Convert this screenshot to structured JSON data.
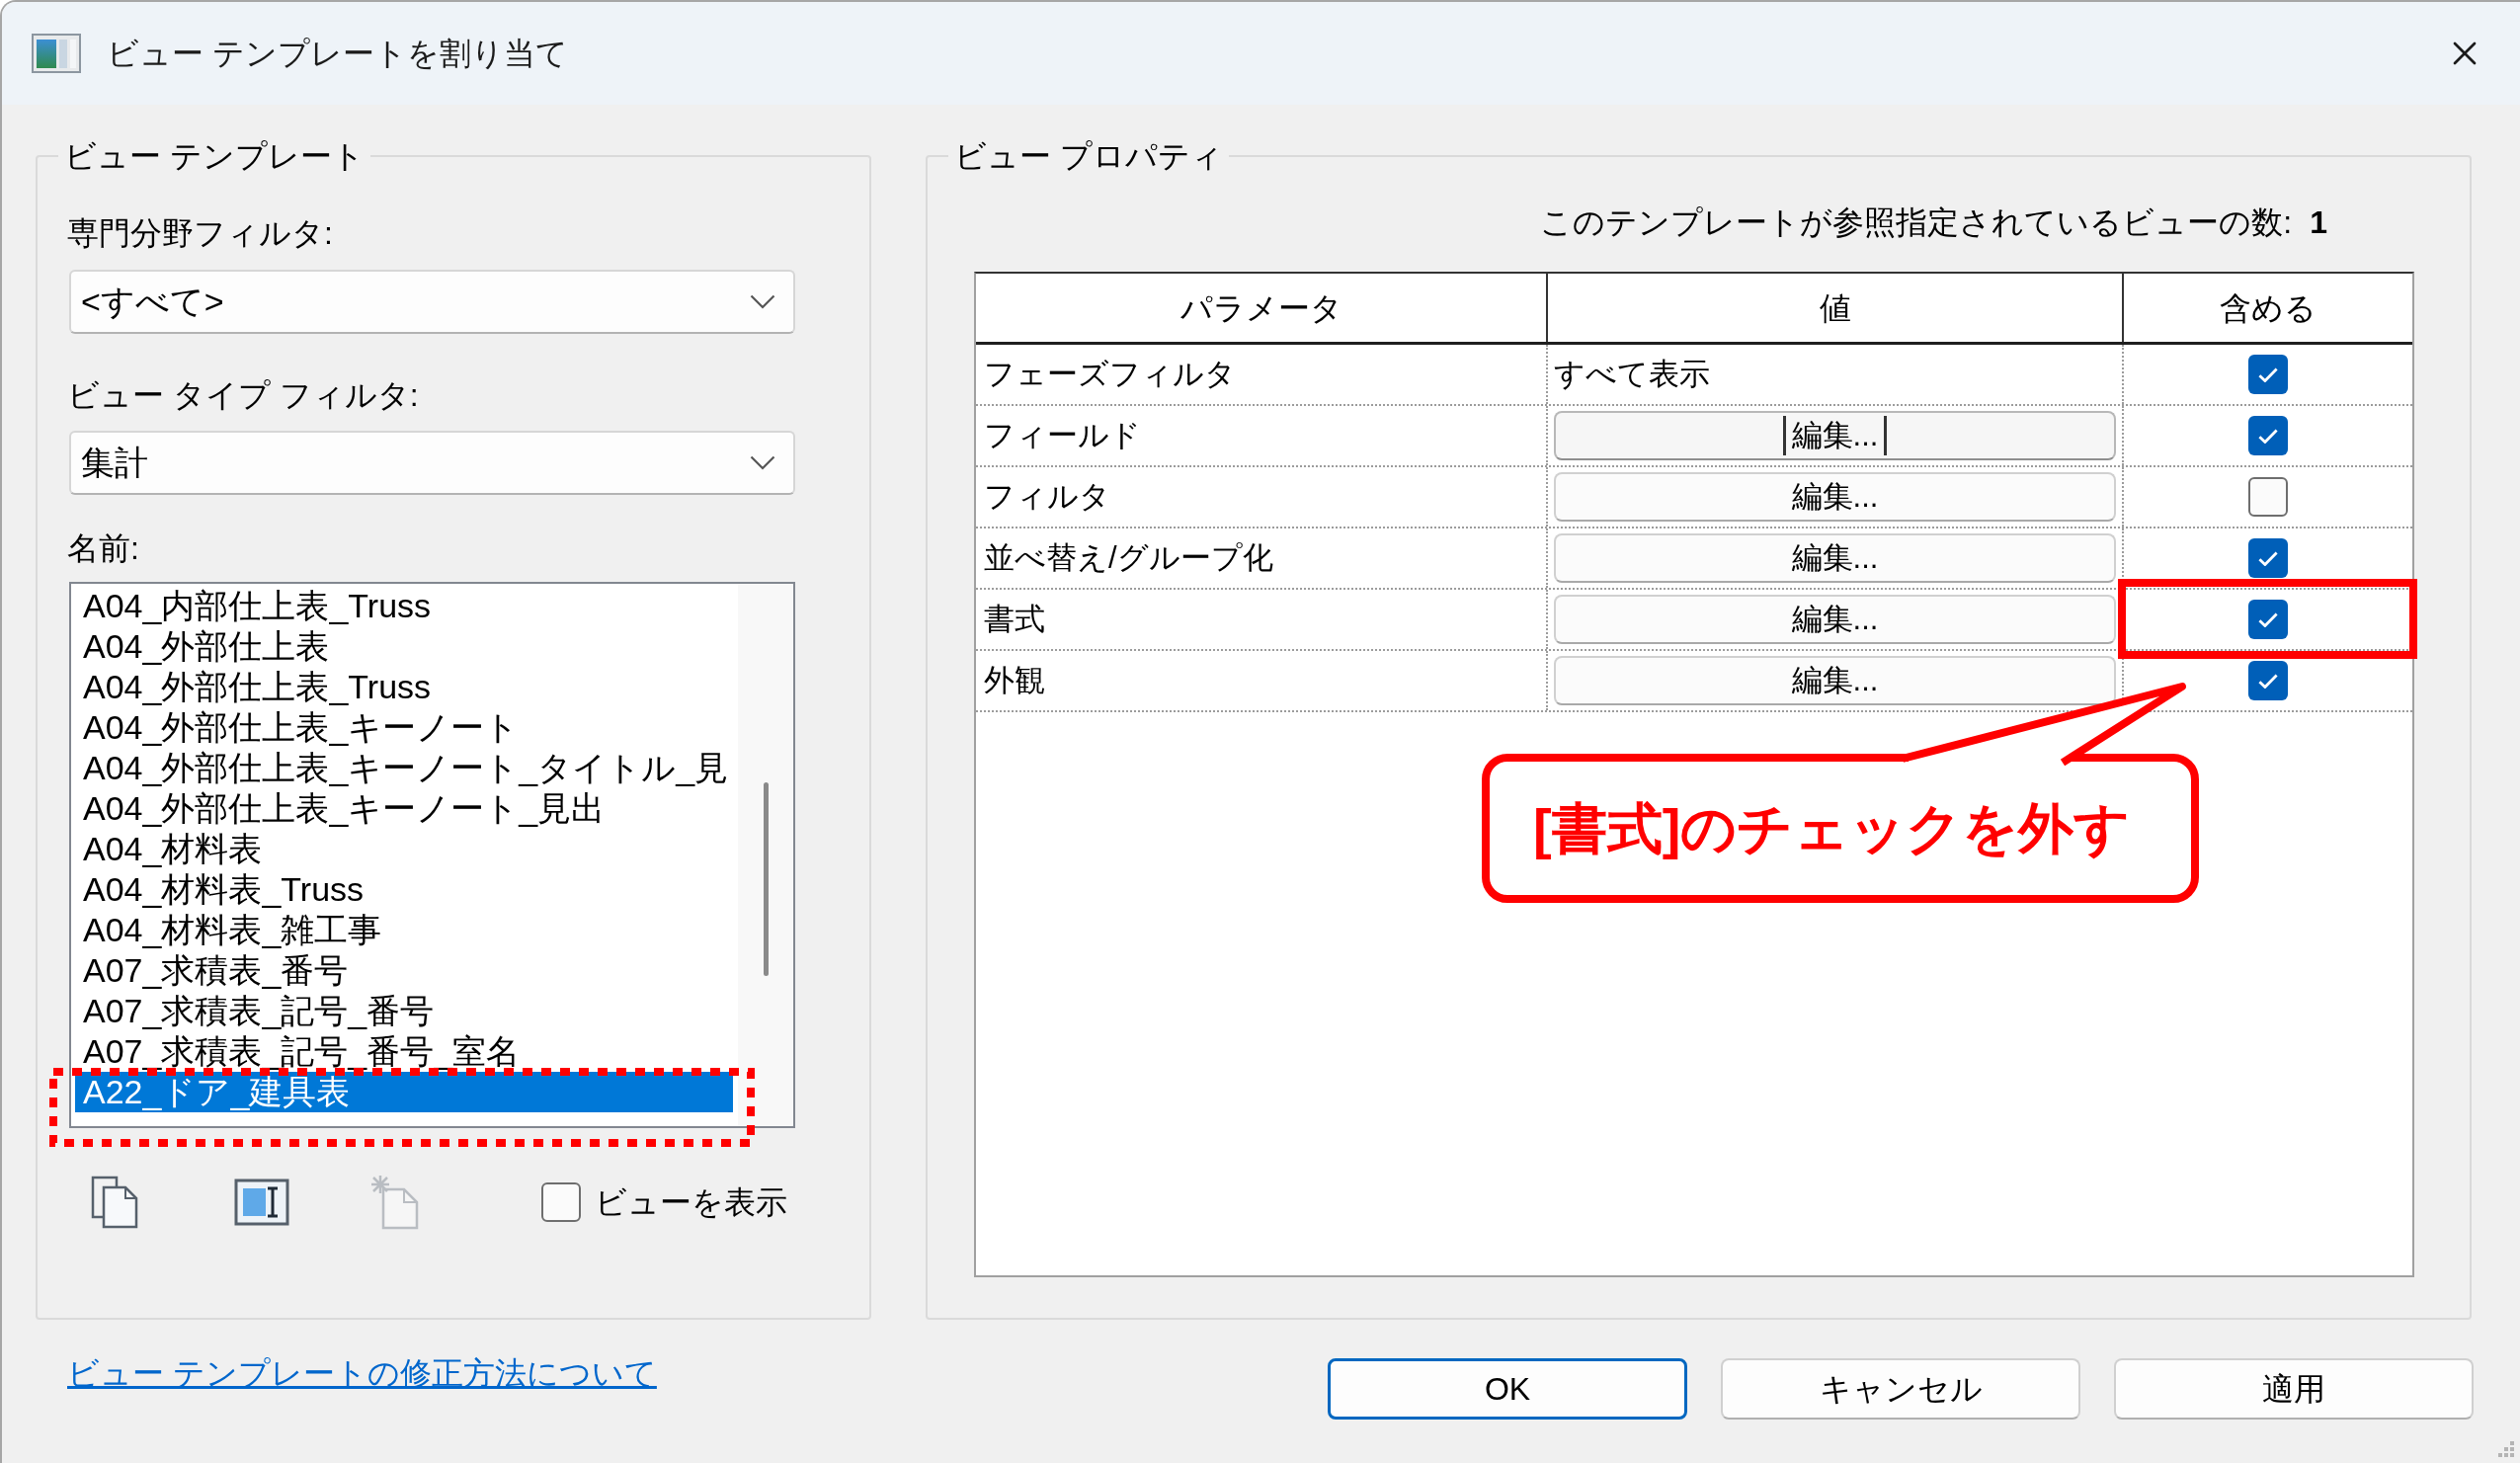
{
  "window": {
    "title": "ビュー テンプレートを割り当て"
  },
  "view_template_group": {
    "legend": "ビュー テンプレート",
    "discipline_filter": {
      "label": "専門分野フィルタ:",
      "value": "<すべて>"
    },
    "view_type_filter": {
      "label": "ビュー タイプ フィルタ:",
      "value": "集計"
    },
    "names": {
      "label": "名前:",
      "items": [
        {
          "text": "A04_内部仕上表_Truss",
          "selected": false
        },
        {
          "text": "A04_外部仕上表",
          "selected": false
        },
        {
          "text": "A04_外部仕上表_Truss",
          "selected": false
        },
        {
          "text": "A04_外部仕上表_キーノート",
          "selected": false
        },
        {
          "text": "A04_外部仕上表_キーノート_タイトル_見",
          "selected": false
        },
        {
          "text": "A04_外部仕上表_キーノート_見出",
          "selected": false
        },
        {
          "text": "A04_材料表",
          "selected": false
        },
        {
          "text": "A04_材料表_Truss",
          "selected": false
        },
        {
          "text": "A04_材料表_雑工事",
          "selected": false
        },
        {
          "text": "A07_求積表_番号",
          "selected": false
        },
        {
          "text": "A07_求積表_記号_番号",
          "selected": false
        },
        {
          "text": "A07_求積表_記号_番号_室名",
          "selected": false
        },
        {
          "text": "A22_ドア_建具表",
          "selected": true
        }
      ]
    },
    "toolbar": [
      {
        "kind": "copy",
        "disabled": false
      },
      {
        "kind": "rename",
        "disabled": false
      },
      {
        "kind": "delete",
        "disabled": true
      }
    ],
    "show_views": {
      "label": "ビューを表示",
      "checked": false
    }
  },
  "view_properties_group": {
    "legend": "ビュー プロパティ",
    "assigned_count": {
      "label": "このテンプレートが参照指定されているビューの数:",
      "value": "1"
    },
    "table": {
      "columns": [
        "パラメータ",
        "値",
        "含める"
      ],
      "rows": [
        {
          "parameter": "フェーズフィルタ",
          "value": {
            "kind": "text",
            "text": "すべて表示"
          },
          "include": true
        },
        {
          "parameter": "フィールド",
          "value": {
            "kind": "button",
            "text": "編集...",
            "focused": true
          },
          "include": true
        },
        {
          "parameter": "フィルタ",
          "value": {
            "kind": "button",
            "text": "編集...",
            "focused": false
          },
          "include": false
        },
        {
          "parameter": "並べ替え/グループ化",
          "value": {
            "kind": "button",
            "text": "編集...",
            "focused": false
          },
          "include": true
        },
        {
          "parameter": "書式",
          "value": {
            "kind": "button",
            "text": "編集...",
            "focused": false
          },
          "include": true
        },
        {
          "parameter": "外観",
          "value": {
            "kind": "button",
            "text": "編集...",
            "focused": false
          },
          "include": true
        }
      ]
    }
  },
  "help_link": "ビュー テンプレートの修正方法について",
  "buttons": [
    {
      "label": "OK",
      "default": true
    },
    {
      "label": "キャンセル",
      "default": false
    },
    {
      "label": "適用",
      "default": false
    }
  ],
  "annotations": [
    {
      "kind": "dotted_frame"
    },
    {
      "kind": "frame"
    },
    {
      "kind": "callout",
      "text": "[書式]のチェックを外す"
    }
  ]
}
